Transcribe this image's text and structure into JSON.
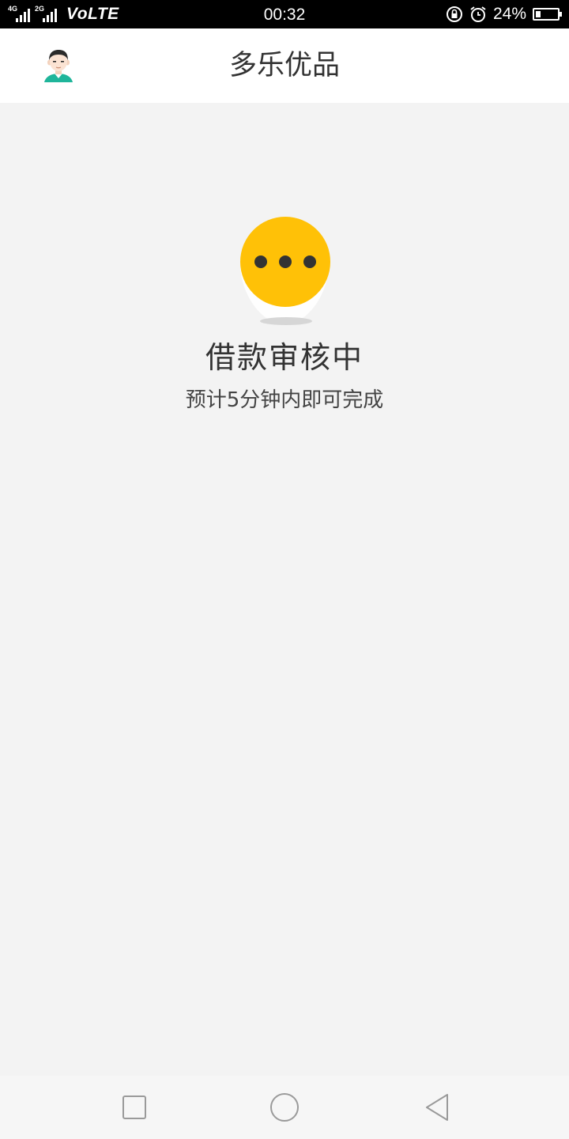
{
  "status_bar": {
    "network_1": "4G",
    "network_2": "2G",
    "volte": "VoLTE",
    "time": "00:32",
    "battery_percent": "24%",
    "battery_level": 0.24,
    "icons": [
      "signal-icon",
      "signal-icon",
      "rotation-lock-icon",
      "alarm-icon",
      "battery-icon"
    ]
  },
  "app_bar": {
    "title": "多乐优品",
    "avatar_icon": "user-avatar-icon"
  },
  "main": {
    "status_icon": "pending-dots-icon",
    "title": "借款审核中",
    "subtitle": "预计5分钟内即可完成"
  },
  "nav_bar": {
    "icons": [
      "recent-apps-icon",
      "home-icon",
      "back-icon"
    ]
  },
  "colors": {
    "accent": "#FFC107",
    "dots": "#333333",
    "background": "#F3F3F3",
    "app_bar": "#FFFFFF",
    "status_bar": "#000000"
  }
}
